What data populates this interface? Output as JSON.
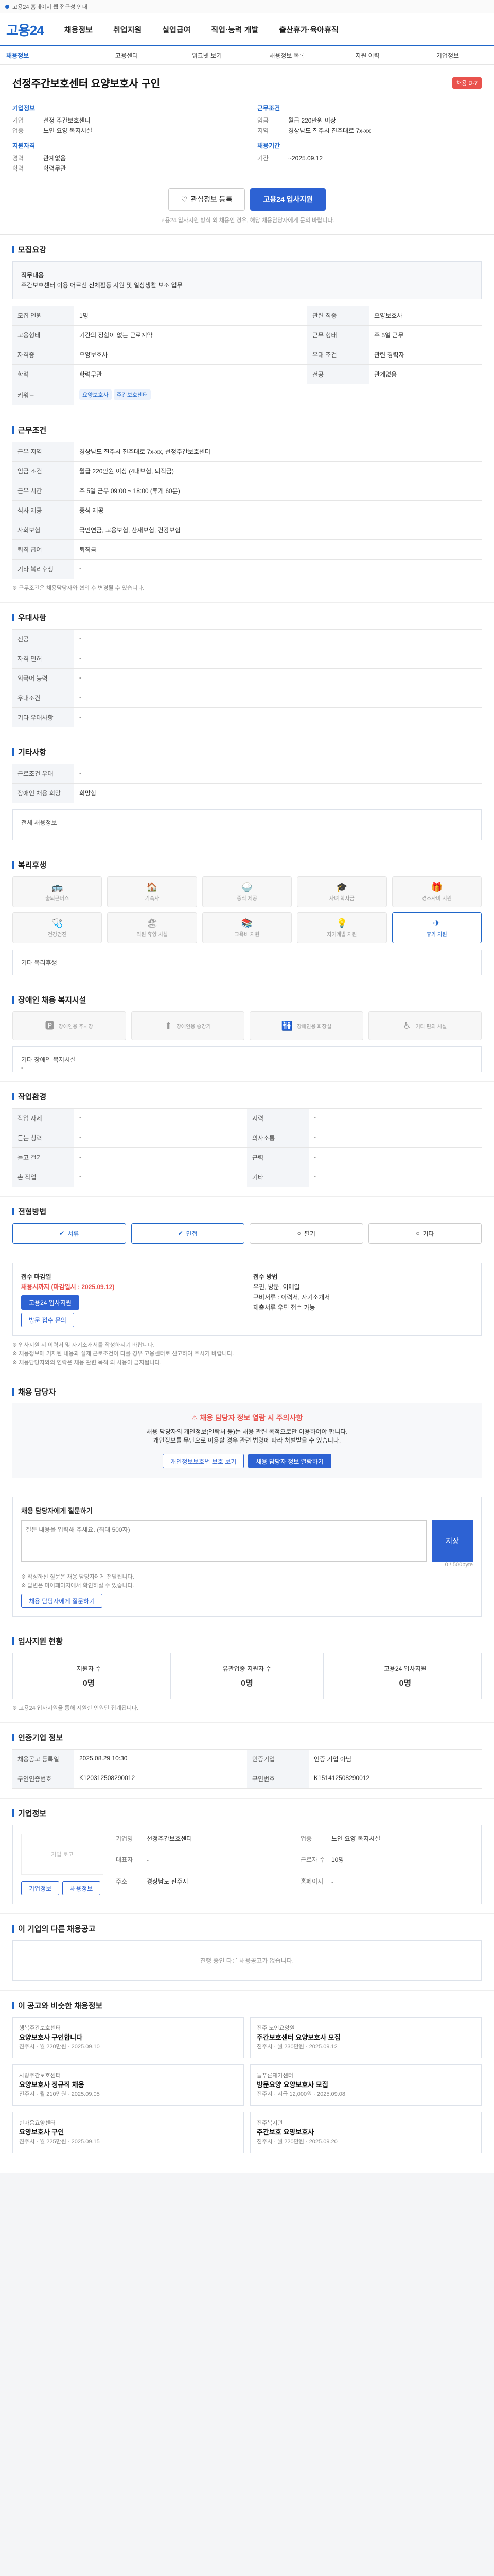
{
  "topbar": {
    "text": "고용24 홈페이지 웹 접근성 안내"
  },
  "header": {
    "logo": "고용24",
    "gnb": [
      "채용정보",
      "취업지원",
      "실업급여",
      "직업·능력 개발",
      "출산휴가·육아휴직"
    ]
  },
  "subnav": [
    "채용정보",
    "고용센터",
    "워크넷 보기",
    "채용정보 목록",
    "지원 이력",
    "기업정보"
  ],
  "job": {
    "title": "선정주간보호센터 요양보호사 구인",
    "badge": "채용 D-7",
    "company_title": "기업정보",
    "company": [
      {
        "k": "기업",
        "v": "선정 주간보호센터"
      },
      {
        "k": "업종",
        "v": "노인 요양 복지시설"
      }
    ],
    "cond_title": "근무조건",
    "cond": [
      {
        "k": "임금",
        "v": "월급 220만원 이상"
      },
      {
        "k": "지역",
        "v": "경상남도 진주시 진주대로 7x-xx"
      }
    ],
    "qual_title": "지원자격",
    "qual": [
      {
        "k": "경력",
        "v": "관계없음"
      },
      {
        "k": "학력",
        "v": "학력무관"
      }
    ],
    "period_title": "채용기간",
    "period": [
      {
        "k": "기간",
        "v": "~2025.09.12"
      }
    ],
    "btn_save": "관심정보 등록",
    "btn_apply": "고용24 입사지원",
    "notice": "고용24 입사지원 방식 외 채용인 경우, 해당 채용담당자에게 문의 바랍니다."
  },
  "recruit": {
    "title": "모집요강",
    "duty_label": "직무내용",
    "duty": "주간보호센터 이용 어르신 신체활동 지원 및 일상생활 보조 업무",
    "rows": [
      {
        "k": "모집 인원",
        "v": "1명",
        "k2": "관련 직종",
        "v2": "요양보호사"
      },
      {
        "k": "고용형태",
        "v": "기간의 정함이 없는 근로계약",
        "k2": "근무 형태",
        "v2": "주 5일 근무"
      },
      {
        "k": "자격증",
        "v": "요양보호사",
        "k2": "우대 조건",
        "v2": "관련 경력자"
      },
      {
        "k": "학력",
        "v": "학력무관",
        "k2": "전공",
        "v2": "관계없음"
      }
    ],
    "tags": [
      "요양보호사",
      "주간보호센터"
    ]
  },
  "work": {
    "title": "근무조건",
    "rows": [
      {
        "k": "근무 지역",
        "v": "경상남도 진주시 진주대로 7x-xx, 선정주간보호센터"
      },
      {
        "k": "임금 조건",
        "v": "월급 220만원 이상 (4대보험, 퇴직금)"
      },
      {
        "k": "근무 시간",
        "v": "주 5일 근무 09:00 ~ 18:00 (휴게 60분)"
      },
      {
        "k": "식사 제공",
        "v": "중식 제공"
      },
      {
        "k": "사회보험",
        "v": "국민연금, 고용보험, 산재보험, 건강보험"
      },
      {
        "k": "퇴직 급여",
        "v": "퇴직금"
      },
      {
        "k": "기타 복리후생",
        "v": "-"
      }
    ],
    "note": "※ 근무조건은 채용담당자와 협의 후 변경될 수 있습니다."
  },
  "benefit": {
    "title": "우대사항",
    "rows": [
      {
        "k": "전공",
        "v": "-"
      },
      {
        "k": "자격 면허",
        "v": "-"
      },
      {
        "k": "외국어 능력",
        "v": "-"
      },
      {
        "k": "우대조건",
        "v": "-"
      },
      {
        "k": "기타 우대사항",
        "v": "-"
      }
    ]
  },
  "etc": {
    "title": "기타사항",
    "rows": [
      {
        "k": "근로조건 우대",
        "v": "-"
      },
      {
        "k": "장애인 채용 희망",
        "v": "희망함"
      }
    ],
    "extra": "전체 채용정보"
  },
  "welfare": {
    "title": "복리후생",
    "items": [
      "출퇴근버스",
      "기숙사",
      "중식 제공",
      "자녀 학자금",
      "경조사비 지원",
      "건강검진",
      "직원 휴양 시설",
      "교육비 지원",
      "자기계발 지원",
      "휴가 지원"
    ],
    "on_index": 9,
    "desc": "기타 복리후생"
  },
  "disability": {
    "title": "장애인 채용 복지시설",
    "items": [
      "장애인용 주차장",
      "장애인용 승강기",
      "장애인용 화장실",
      "기타 편의 시설"
    ],
    "extra": "기타 장애인 복지시설",
    "extra_v": "-"
  },
  "env": {
    "title": "작업환경",
    "rows": [
      {
        "k": "작업 자세",
        "v": "-",
        "k2": "시력",
        "v2": "-"
      },
      {
        "k": "듣는 청력",
        "v": "-",
        "k2": "의사소통",
        "v2": "-"
      },
      {
        "k": "들고 걸기",
        "v": "-",
        "k2": "근력",
        "v2": "-"
      },
      {
        "k": "손 작업",
        "v": "-",
        "k2": "기타",
        "v2": "-"
      }
    ]
  },
  "method": {
    "title": "전형방법",
    "items": [
      "서류",
      "면접",
      "필기",
      "기타"
    ],
    "on": [
      0,
      1
    ]
  },
  "apply": {
    "col1_title": "접수 마감일",
    "dday": "채용시까지 (마감일시 : 2025.09.12)",
    "btn_apply": "고용24 입사지원",
    "btn_other": "방문 접수 문의",
    "col2_title": "접수 방법",
    "col2_lines": [
      "우편, 방문, 이메일",
      "구비서류 : 이력서, 자기소개서",
      "제출서류 우편 접수 가능"
    ],
    "fine": [
      "※ 입사지원 시 이력서 및 자기소개서를 작성하시기 바랍니다.",
      "※ 채용정보에 기재된 내용과 실제 근로조건이 다를 경우 고용센터로 신고하여 주시기 바랍니다.",
      "※ 채용담당자와의 연락은 채용 관련 목적 외 사용이 금지됩니다."
    ]
  },
  "contact": {
    "title": "채용 담당자",
    "warn": "채용 담당자 정보 열람 시 주의사항",
    "lines": [
      "채용 담당자의 개인정보(연락처 등)는 채용 관련 목적으로만 이용하여야 합니다.",
      "개인정보를 무단으로 이용할 경우 관련 법령에 따라 처벌받을 수 있습니다."
    ],
    "btn1": "개인정보보호법 보호 보기",
    "btn2": "채용 담당자 정보 열람하기"
  },
  "qa": {
    "title": "채용 담당자에게 질문하기",
    "placeholder": "질문 내용을 입력해 주세요. (최대 500자)",
    "count": "0 / 500byte",
    "submit": "저장",
    "fine": [
      "※ 작성하신 질문은 채용 담당자에게 전달됩니다.",
      "※ 답변은 마이페이지에서 확인하실 수 있습니다."
    ],
    "btn": "채용 담당자에게 질문하기"
  },
  "stats": {
    "title": "입사지원 현황",
    "items": [
      {
        "label": "지원자 수",
        "v": "0명"
      },
      {
        "label": "유관업종 지원자 수",
        "v": "0명"
      },
      {
        "label": "고용24 입사지원",
        "v": "0명"
      }
    ],
    "fine": "※ 고용24 입사지원을 통해 지원한 인원만 집계됩니다."
  },
  "info": {
    "title": "인증기업 정보",
    "rows": [
      {
        "k": "채용공고 등록일",
        "v": "2025.08.29 10:30",
        "k2": "인증기업",
        "v2": "인증 기업 아님"
      },
      {
        "k": "구인인증번호",
        "v": "K120312508290012",
        "k2": "구인번호",
        "v2": "K151412508290012"
      }
    ]
  },
  "org": {
    "title": "기업정보",
    "logo": "기업 로고",
    "fields": [
      {
        "k": "기업명",
        "v": "선정주간보호센터"
      },
      {
        "k": "업종",
        "v": "노인 요양 복지시설"
      },
      {
        "k": "대표자",
        "v": "-"
      },
      {
        "k": "근로자 수",
        "v": "10명"
      },
      {
        "k": "주소",
        "v": "경상남도 진주시"
      },
      {
        "k": "홈페이지",
        "v": "-"
      }
    ],
    "btn1": "기업정보",
    "btn2": "채용정보"
  },
  "other": {
    "title": "이 기업의 다른 채용공고",
    "empty": "진행 중인 다른 채용공고가 없습니다."
  },
  "recommend": {
    "title": "이 공고와 비슷한 채용정보",
    "items": [
      {
        "co": "행복주간보호센터",
        "tt": "요양보호사 구인합니다",
        "meta": "진주시 · 월 220만원 · 2025.09.10"
      },
      {
        "co": "진주 노인요양원",
        "tt": "주간보호센터 요양보호사 모집",
        "meta": "진주시 · 월 230만원 · 2025.09.12"
      },
      {
        "co": "사랑주간보호센터",
        "tt": "요양보호사 정규직 채용",
        "meta": "진주시 · 월 210만원 · 2025.09.05"
      },
      {
        "co": "늘푸른재가센터",
        "tt": "방문요양 요양보호사 모집",
        "meta": "진주시 · 시급 12,000원 · 2025.09.08"
      },
      {
        "co": "한마음요양센터",
        "tt": "요양보호사 구인",
        "meta": "진주시 · 월 225만원 · 2025.09.15"
      },
      {
        "co": "진주복지관",
        "tt": "주간보호 요양보호사",
        "meta": "진주시 · 월 220만원 · 2025.09.20"
      }
    ]
  }
}
